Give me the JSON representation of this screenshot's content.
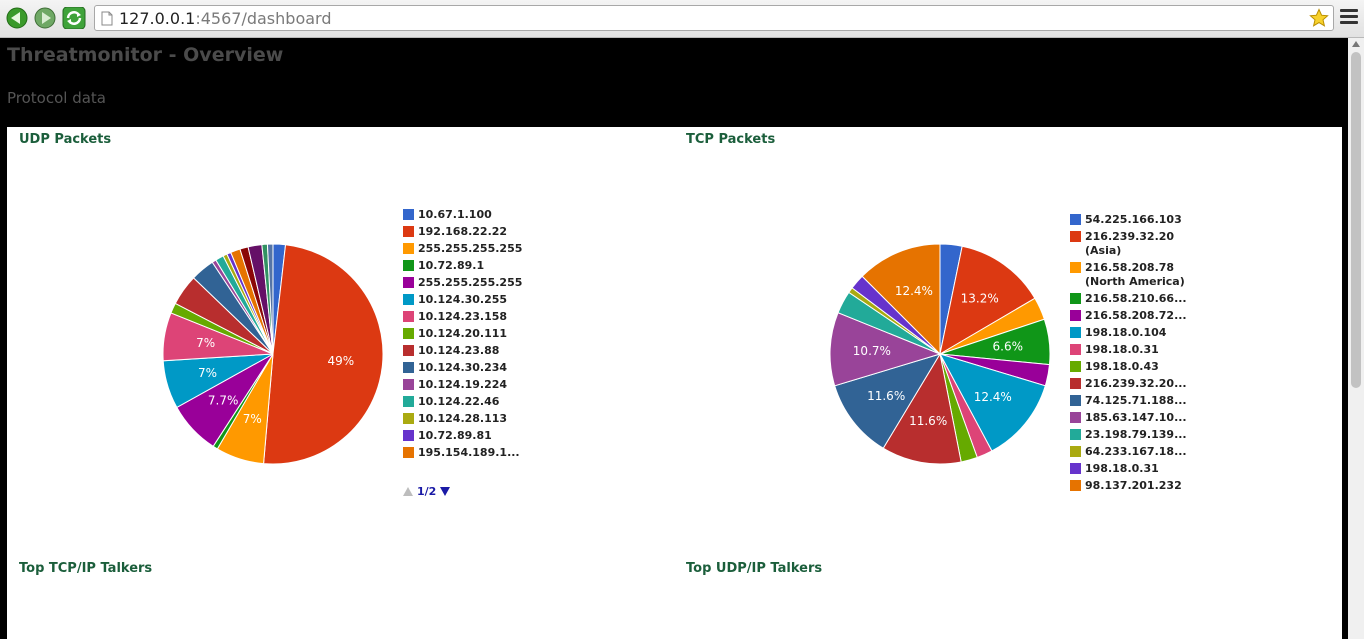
{
  "browser": {
    "url_host": "127.0.0.1",
    "url_path": ":4567/dashboard"
  },
  "page": {
    "title": "Threatmonitor - Overview",
    "subtitle": "Protocol data"
  },
  "widgets": {
    "udp_packets": {
      "title": "UDP Packets",
      "pager_label": "1/2",
      "legend": [
        {
          "label": "10.67.1.100",
          "color": "#3366cc"
        },
        {
          "label": "192.168.22.22",
          "color": "#dc3912"
        },
        {
          "label": "255.255.255.255",
          "color": "#ff9900"
        },
        {
          "label": "10.72.89.1",
          "color": "#109618"
        },
        {
          "label": "255.255.255.255",
          "color": "#990099"
        },
        {
          "label": "10.124.30.255",
          "color": "#0099c6"
        },
        {
          "label": "10.124.23.158",
          "color": "#dd4477"
        },
        {
          "label": "10.124.20.111",
          "color": "#66aa00"
        },
        {
          "label": "10.124.23.88",
          "color": "#b82e2e"
        },
        {
          "label": "10.124.30.234",
          "color": "#316395"
        },
        {
          "label": "10.124.19.224",
          "color": "#994499"
        },
        {
          "label": "10.124.22.46",
          "color": "#22aa99"
        },
        {
          "label": "10.124.28.113",
          "color": "#aaaa11"
        },
        {
          "label": "10.72.89.81",
          "color": "#6633cc"
        },
        {
          "label": "195.154.189.1...",
          "color": "#e67300"
        }
      ]
    },
    "tcp_packets": {
      "title": "TCP Packets",
      "legend": [
        {
          "label": "54.225.166.103",
          "sub": "",
          "color": "#3366cc"
        },
        {
          "label": "216.239.32.20",
          "sub": "(Asia)",
          "color": "#dc3912"
        },
        {
          "label": "216.58.208.78",
          "sub": "(North America)",
          "color": "#ff9900"
        },
        {
          "label": "216.58.210.66...",
          "sub": "",
          "color": "#109618"
        },
        {
          "label": "216.58.208.72...",
          "sub": "",
          "color": "#990099"
        },
        {
          "label": "198.18.0.104",
          "sub": "",
          "color": "#0099c6"
        },
        {
          "label": "198.18.0.31",
          "sub": "",
          "color": "#dd4477"
        },
        {
          "label": "198.18.0.43",
          "sub": "",
          "color": "#66aa00"
        },
        {
          "label": "216.239.32.20...",
          "sub": "",
          "color": "#b82e2e"
        },
        {
          "label": "74.125.71.188...",
          "sub": "",
          "color": "#316395"
        },
        {
          "label": "185.63.147.10...",
          "sub": "",
          "color": "#994499"
        },
        {
          "label": "23.198.79.139...",
          "sub": "",
          "color": "#22aa99"
        },
        {
          "label": "64.233.167.18...",
          "sub": "",
          "color": "#aaaa11"
        },
        {
          "label": "198.18.0.31",
          "sub": "",
          "color": "#6633cc"
        },
        {
          "label": "98.137.201.232",
          "sub": "",
          "color": "#e67300"
        }
      ]
    },
    "top_tcp_talkers": {
      "title": "Top TCP/IP Talkers"
    },
    "top_udp_talkers": {
      "title": "Top UDP/IP Talkers"
    }
  },
  "chart_data": [
    {
      "type": "pie",
      "title": "UDP Packets",
      "slices": [
        {
          "value": 1.8,
          "color": "#3366cc",
          "label": ""
        },
        {
          "value": 49.0,
          "color": "#dc3912",
          "label": "49%"
        },
        {
          "value": 7.0,
          "color": "#ff9900",
          "label": "7%"
        },
        {
          "value": 0.7,
          "color": "#109618",
          "label": ""
        },
        {
          "value": 7.7,
          "color": "#990099",
          "label": "7.7%"
        },
        {
          "value": 7.0,
          "color": "#0099c6",
          "label": "7%"
        },
        {
          "value": 7.0,
          "color": "#dd4477",
          "label": "7%"
        },
        {
          "value": 1.5,
          "color": "#66aa00",
          "label": ""
        },
        {
          "value": 4.5,
          "color": "#b82e2e",
          "label": ""
        },
        {
          "value": 3.5,
          "color": "#316395",
          "label": ""
        },
        {
          "value": 0.6,
          "color": "#994499",
          "label": ""
        },
        {
          "value": 1.2,
          "color": "#22aa99",
          "label": ""
        },
        {
          "value": 0.6,
          "color": "#aaaa11",
          "label": ""
        },
        {
          "value": 0.6,
          "color": "#6633cc",
          "label": ""
        },
        {
          "value": 1.4,
          "color": "#e67300",
          "label": ""
        },
        {
          "value": 1.2,
          "color": "#8b0707",
          "label": ""
        },
        {
          "value": 2.0,
          "color": "#651067",
          "label": ""
        },
        {
          "value": 0.8,
          "color": "#329262",
          "label": ""
        },
        {
          "value": 0.8,
          "color": "#5574a6",
          "label": ""
        }
      ]
    },
    {
      "type": "pie",
      "title": "TCP Packets",
      "slices": [
        {
          "value": 3.2,
          "color": "#3366cc",
          "label": ""
        },
        {
          "value": 13.2,
          "color": "#dc3912",
          "label": "13.2%"
        },
        {
          "value": 3.3,
          "color": "#ff9900",
          "label": ""
        },
        {
          "value": 6.6,
          "color": "#109618",
          "label": "6.6%"
        },
        {
          "value": 3.1,
          "color": "#990099",
          "label": ""
        },
        {
          "value": 12.4,
          "color": "#0099c6",
          "label": "12.4%"
        },
        {
          "value": 2.3,
          "color": "#dd4477",
          "label": ""
        },
        {
          "value": 2.4,
          "color": "#66aa00",
          "label": ""
        },
        {
          "value": 11.6,
          "color": "#b82e2e",
          "label": "11.6%"
        },
        {
          "value": 11.6,
          "color": "#316395",
          "label": "11.6%"
        },
        {
          "value": 10.7,
          "color": "#994499",
          "label": "10.7%"
        },
        {
          "value": 3.3,
          "color": "#22aa99",
          "label": ""
        },
        {
          "value": 0.8,
          "color": "#aaaa11",
          "label": ""
        },
        {
          "value": 2.2,
          "color": "#6633cc",
          "label": ""
        },
        {
          "value": 12.4,
          "color": "#e67300",
          "label": "12.4%"
        }
      ]
    }
  ]
}
